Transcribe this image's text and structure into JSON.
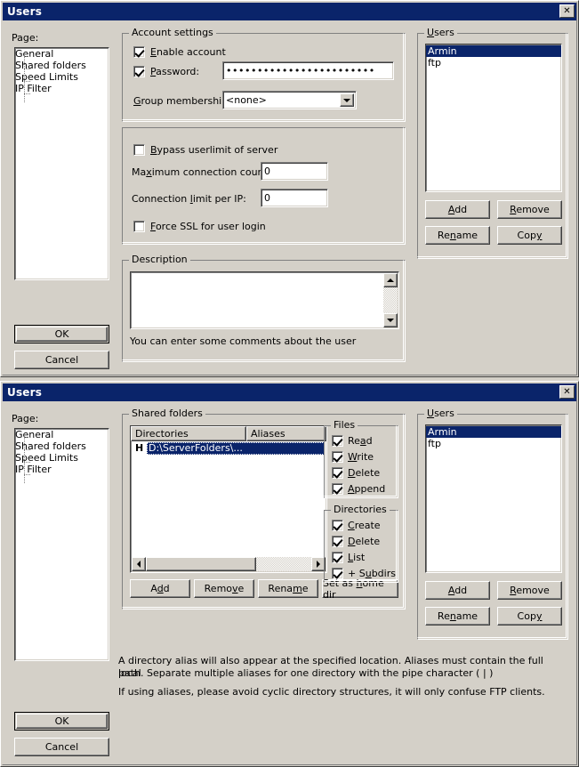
{
  "window1": {
    "title": "Users",
    "close_label": "✕",
    "page_label": "Page:",
    "tree": {
      "items": [
        {
          "label": "General",
          "selected": true
        },
        {
          "label": "Shared folders",
          "selected": false
        },
        {
          "label": "Speed Limits",
          "selected": false
        },
        {
          "label": "IP Filter",
          "selected": false
        }
      ]
    },
    "account_settings": {
      "legend": "Account settings",
      "enable_account": {
        "label": "Enable account",
        "accel": "E",
        "checked": true
      },
      "password": {
        "label": "Password:",
        "accel": "P",
        "checked": true,
        "value": "••••••••••••••••••••••••"
      },
      "group_membership": {
        "label": "Group membership:",
        "accel": "G",
        "value": "<none>"
      }
    },
    "limits": {
      "bypass": {
        "label": "Bypass userlimit of server",
        "accel": "B",
        "checked": false
      },
      "max_conn": {
        "label": "Maximum connection count:",
        "accel": "x",
        "value": "0"
      },
      "conn_per_ip": {
        "label": "Connection limit per IP:",
        "accel": "l",
        "value": "0"
      },
      "force_ssl": {
        "label": "Force SSL for user login",
        "accel": "F",
        "checked": false
      }
    },
    "description": {
      "legend": "Description",
      "value": "",
      "hint": "You can enter some comments about the user"
    },
    "users_panel": {
      "legend": "Users",
      "legend_accel": "U",
      "items": [
        {
          "label": "Armin",
          "selected": true
        },
        {
          "label": "ftp",
          "selected": false
        }
      ],
      "buttons": [
        {
          "label": "Add",
          "accel": "A"
        },
        {
          "label": "Remove",
          "accel": "R"
        },
        {
          "label": "Rename",
          "accel": "n"
        },
        {
          "label": "Copy",
          "accel": "y"
        }
      ]
    },
    "ok_label": "OK",
    "cancel_label": "Cancel"
  },
  "window2": {
    "title": "Users",
    "close_label": "✕",
    "page_label": "Page:",
    "tree": {
      "items": [
        {
          "label": "General",
          "selected": false
        },
        {
          "label": "Shared folders",
          "selected": true
        },
        {
          "label": "Speed Limits",
          "selected": false
        },
        {
          "label": "IP Filter",
          "selected": false
        }
      ]
    },
    "shared_folders": {
      "legend": "Shared folders",
      "columns": [
        "Directories",
        "Aliases"
      ],
      "rows": [
        {
          "marker": "H",
          "directory": "D:\\ServerFolders\\...",
          "alias": "",
          "selected": true
        }
      ],
      "buttons": [
        {
          "label": "Add",
          "accel": "d"
        },
        {
          "label": "Remove",
          "accel": "v"
        },
        {
          "label": "Rename",
          "accel": "m"
        },
        {
          "label": "Set as home dir",
          "accel": "h"
        }
      ]
    },
    "files_group": {
      "legend": "Files",
      "items": [
        {
          "label": "Read",
          "accel": "a",
          "checked": true
        },
        {
          "label": "Write",
          "accel": "W",
          "checked": true
        },
        {
          "label": "Delete",
          "accel": "D",
          "checked": true
        },
        {
          "label": "Append",
          "accel": "A",
          "checked": true
        }
      ]
    },
    "directories_group": {
      "legend": "Directories",
      "items": [
        {
          "label": "Create",
          "accel": "C",
          "checked": true
        },
        {
          "label": "Delete",
          "accel": "D",
          "checked": true
        },
        {
          "label": "List",
          "accel": "L",
          "checked": true
        },
        {
          "label": "+ Subdirs",
          "accel": "S",
          "checked": true
        }
      ]
    },
    "users_panel": {
      "legend": "Users",
      "legend_accel": "U",
      "items": [
        {
          "label": "Armin",
          "selected": true
        },
        {
          "label": "ftp",
          "selected": false
        }
      ],
      "buttons": [
        {
          "label": "Add",
          "accel": "A"
        },
        {
          "label": "Remove",
          "accel": "R"
        },
        {
          "label": "Rename",
          "accel": "n"
        },
        {
          "label": "Copy",
          "accel": "y"
        }
      ]
    },
    "help_text": [
      "A directory alias will also appear at the specified location. Aliases must contain the full local",
      "path. Separate multiple aliases for one directory with the pipe character ( | )",
      "If using aliases, please avoid cyclic directory structures, it will only confuse FTP clients."
    ],
    "ok_label": "OK",
    "cancel_label": "Cancel"
  },
  "colors": {
    "titlebar": "#0a246a",
    "face": "#d4d0c8",
    "selection": "#0a246a",
    "selection_inactive": "#c0bcb4"
  }
}
